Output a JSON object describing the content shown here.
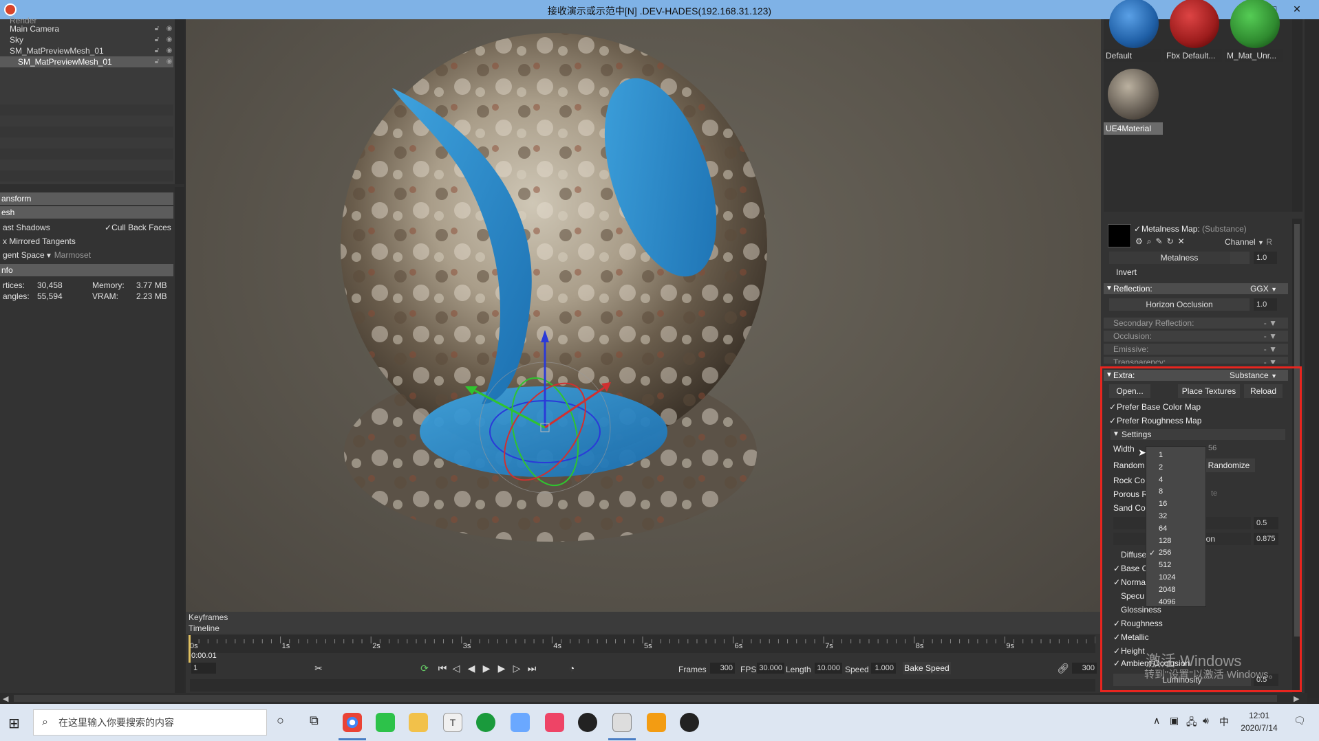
{
  "window": {
    "title": "接收演示或示范中[N] .DEV-HADES(192.168.31.123)",
    "min": "—",
    "max": "□",
    "close": "✕"
  },
  "outliner": {
    "items": [
      {
        "label": "Render"
      },
      {
        "label": "Main Camera"
      },
      {
        "label": "Sky"
      },
      {
        "label": "SM_MatPreviewMesh_01"
      },
      {
        "label": "SM_MatPreviewMesh_01"
      }
    ]
  },
  "properties": {
    "transform": "ansform",
    "mesh": "esh",
    "cast_shadows": "ast Shadows",
    "cull_back_faces": "Cull Back Faces",
    "fix_mirrored": "x Mirrored Tangents",
    "tangent_space_label": "gent Space",
    "tangent_space_value": "Marmoset",
    "info": "nfo",
    "vertices_label": "rtices:",
    "vertices_value": "30,458",
    "memory_label": "Memory:",
    "memory_value": "3.77 MB",
    "triangles_label": "angles:",
    "triangles_value": "55,594",
    "vram_label": "VRAM:",
    "vram_value": "2.23 MB"
  },
  "timeline": {
    "keyframes": "Keyframes",
    "timeline": "Timeline",
    "start_tick": "0s",
    "ticks": [
      "1s",
      "2s",
      "3s",
      "4s",
      "5s",
      "6s",
      "7s",
      "8s",
      "9s"
    ],
    "current_time": "0:00.01",
    "frame_field": "1",
    "frames_label": "Frames",
    "frames_value": "300",
    "fps_label": "FPS",
    "fps_value": "30.000",
    "length_label": "Length",
    "length_value": "10.000",
    "speed_label": "Speed",
    "speed_value": "1.000",
    "bake_speed": "Bake Speed",
    "end_frames": "300"
  },
  "materials": {
    "swatches": [
      {
        "label": "Default",
        "color": "#1f5fa6"
      },
      {
        "label": "Fbx Default...",
        "color": "#9c1c1c"
      },
      {
        "label": "M_Mat_Unr...",
        "color": "#2f8a2f"
      },
      {
        "label": "UE4Material",
        "color": "#6a6258"
      }
    ]
  },
  "inspector": {
    "metalness_map_label": "Metalness Map:",
    "metalness_map_source": "(Substance)",
    "channel_label": "Channel",
    "channel_value": "R",
    "metalness_label": "Metalness",
    "metalness_value": "1.0",
    "invert_label": "Invert",
    "reflection_label": "Reflection:",
    "reflection_value": "GGX",
    "horizon_occlusion_label": "Horizon Occlusion",
    "horizon_occlusion_value": "1.0",
    "secondary_reflection": "Secondary Reflection:",
    "occlusion": "Occlusion:",
    "emissive": "Emissive:",
    "transparency": "Transparency:",
    "none_value": "-",
    "extra_label": "Extra:",
    "extra_value": "Substance",
    "open_btn": "Open...",
    "place_textures_btn": "Place Textures",
    "reload_btn": "Reload",
    "prefer_base_color": "Prefer Base Color Map",
    "prefer_roughness": "Prefer Roughness Map",
    "settings_label": "Settings",
    "width_label": "Width",
    "width_value_partial": "56",
    "random_label": "Random",
    "randomize_btn": "Randomize",
    "rock_label": "Rock Co",
    "porous_label": "Porous R",
    "porous_partial": "te",
    "sand_label": "Sand Co",
    "slider1_value": "0.5",
    "slider2_partial": "ion",
    "slider2_value": "0.875",
    "output_diffuse": "Diffuse",
    "output_base": "Base C",
    "output_normal": "Norma",
    "output_specular": "Specu",
    "output_glossiness": "Glossiness",
    "output_roughness": "Roughness",
    "output_metallic": "Metallic",
    "output_height": "Height",
    "output_ao": "Ambient Occlusion",
    "luminosity_label": "Luminosity",
    "luminosity_value": "0.5"
  },
  "width_dropdown": {
    "options": [
      "1",
      "2",
      "4",
      "8",
      "16",
      "32",
      "64",
      "128",
      "256",
      "512",
      "1024",
      "2048",
      "4096"
    ],
    "selected": "256"
  },
  "watermark": {
    "line1": "激活 Windows",
    "line2": "转到\"设置\"以激活 Windows。"
  },
  "taskbar": {
    "search_placeholder": "在这里输入你要搜索的内容",
    "time": "12:01",
    "date": "2020/7/14",
    "ime": "中"
  }
}
